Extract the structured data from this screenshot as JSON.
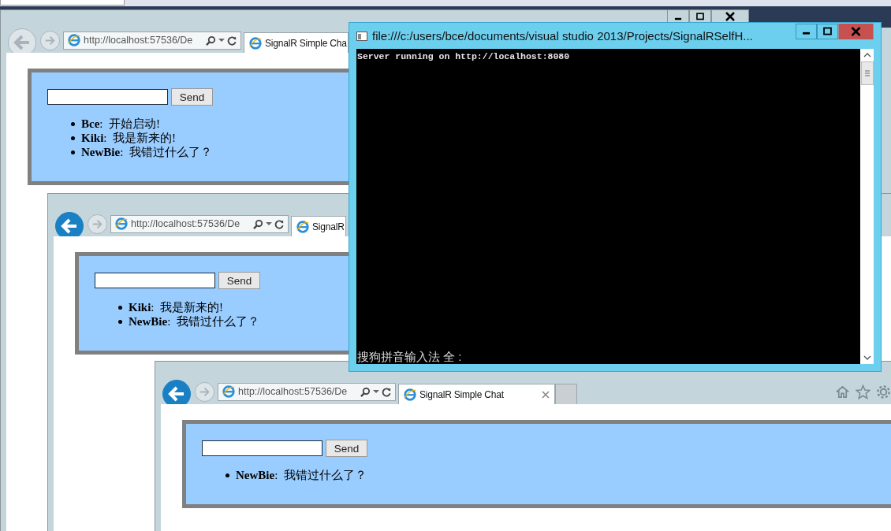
{
  "browsers": [
    {
      "back_enabled": false,
      "address": "http://localhost:57536/De",
      "tab_title": "SignalR Simple Cha",
      "tab_close": false,
      "send_label": "Send",
      "messages": [
        "**Bce**:  开始启动!",
        "**Kiki**:  我是新来的!",
        "**NewBie**:  我错过什么了？"
      ]
    },
    {
      "back_enabled": true,
      "address": "http://localhost:57536/De",
      "tab_title": "SignalR",
      "tab_close": false,
      "send_label": "Send",
      "messages": [
        "**Kiki**:  我是新来的!",
        "**NewBie**:  我错过什么了？"
      ]
    },
    {
      "back_enabled": true,
      "address": "http://localhost:57536/De",
      "tab_title": "SignalR Simple Chat",
      "tab_close": true,
      "send_label": "Send",
      "messages": [
        "**NewBie**:  我错过什么了？"
      ]
    }
  ],
  "console": {
    "title": "file:///c:/users/bce/documents/visual studio 2013/Projects/SignalRSelfH...",
    "lines": [
      "Server running on http://localhost:8080"
    ],
    "ime_status": "搜狗拼音输入法 全 :"
  }
}
